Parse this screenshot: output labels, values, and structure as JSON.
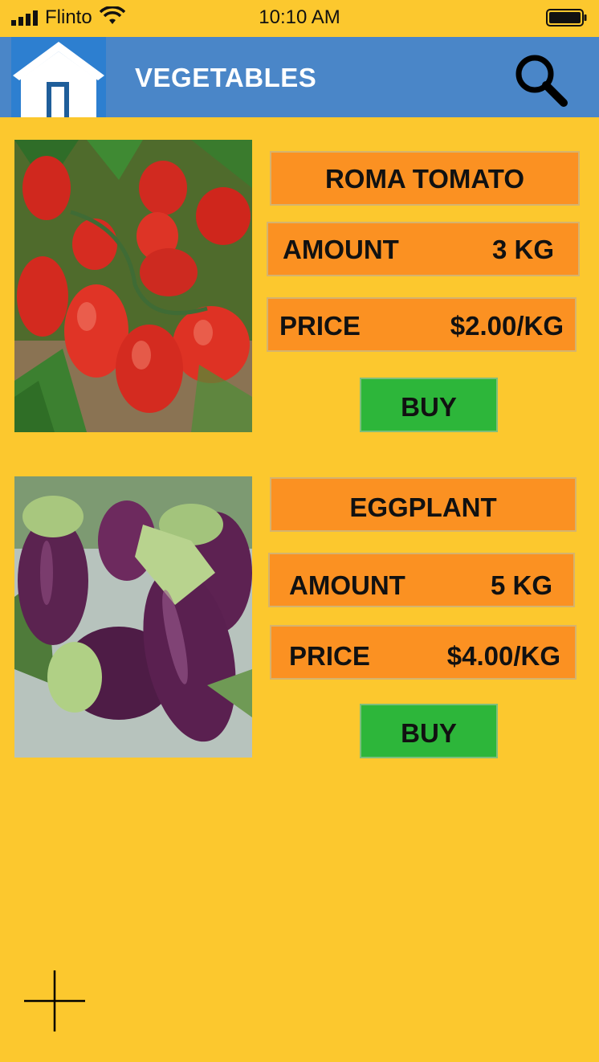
{
  "status_bar": {
    "carrier": "Flinto",
    "time": "10:10 AM"
  },
  "header": {
    "title": "VEGETABLES",
    "home_icon": "home-icon",
    "search_icon": "search-icon"
  },
  "products": [
    {
      "name": "ROMA TOMATO",
      "amount_label": "AMOUNT",
      "amount_value": "3 KG",
      "price_label": "PRICE",
      "price_value": "$2.00/KG",
      "buy_label": "BUY"
    },
    {
      "name": "EGGPLANT",
      "amount_label": "AMOUNT",
      "amount_value": "5 KG",
      "price_label": "PRICE",
      "price_value": "$4.00/KG",
      "buy_label": "BUY"
    }
  ],
  "footer": {
    "add_icon": "plus-icon"
  },
  "colors": {
    "background": "#fcc82e",
    "header": "#4a86c8",
    "pill": "#fb9122",
    "buy": "#2db63a"
  }
}
